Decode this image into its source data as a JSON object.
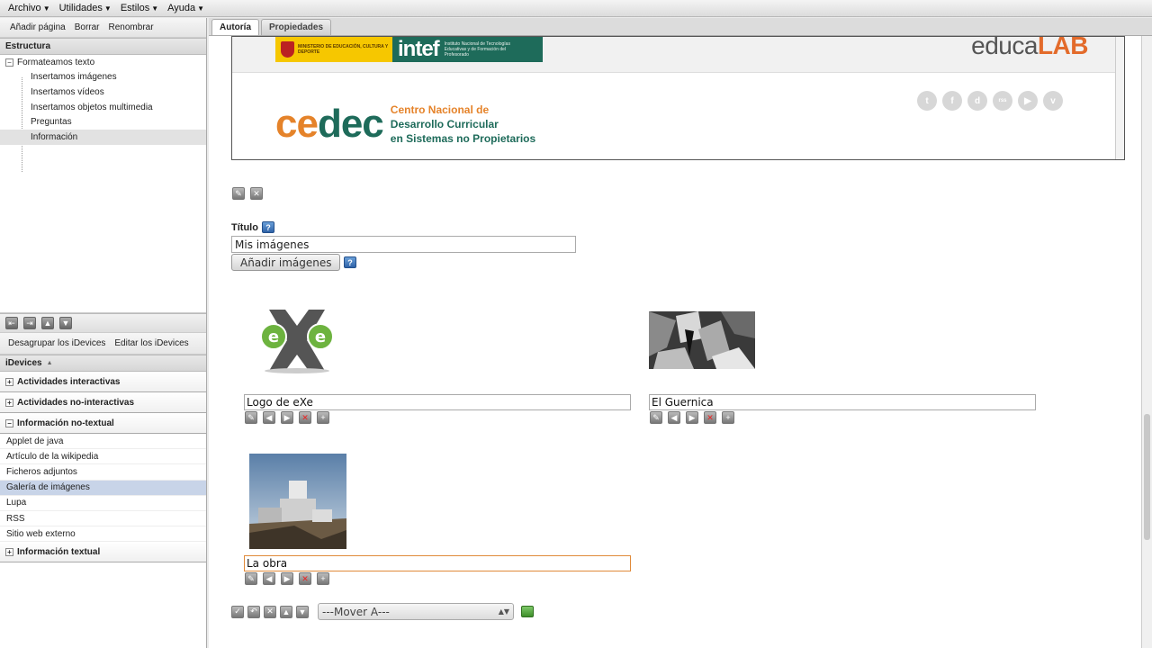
{
  "menubar": {
    "items": [
      "Archivo",
      "Utilidades",
      "Estilos",
      "Ayuda"
    ]
  },
  "left": {
    "toolbar": [
      "Añadir página",
      "Borrar",
      "Renombrar"
    ],
    "structure_title": "Estructura",
    "tree_root": "Formateamos texto",
    "tree_children": [
      "Insertamos imágenes",
      "Insertamos vídeos",
      "Insertamos objetos multimedia",
      "Preguntas",
      "Información"
    ],
    "selected_child_index": 4,
    "idevice_toolbar": [
      "Desagrupar los iDevices",
      "Editar los iDevices"
    ],
    "idevices_title": "iDevices",
    "groups": [
      "Actividades interactivas",
      "Actividades no-interactivas",
      "Información no-textual",
      "Información textual"
    ],
    "nontextual_items": [
      "Applet de java",
      "Artículo de la wikipedia",
      "Ficheros adjuntos",
      "Galería de imágenes",
      "Lupa",
      "RSS",
      "Sitio web externo"
    ],
    "selected_item_index": 3
  },
  "right": {
    "tabs": [
      "Autoría",
      "Propiedades"
    ],
    "active_tab": "Autoría",
    "header": {
      "intef_word": "intef",
      "intef_sub": "Instituto Nacional de Tecnologías Educativas y de Formación del Profesorado",
      "gob_text": "MINISTERIO DE EDUCACIÓN, CULTURA Y DEPORTE",
      "educalab_a": "educa",
      "educalab_b": "LAB",
      "cedec_a": "ce",
      "cedec_b": "dec",
      "cedec_desc_1": "Centro Nacional de",
      "cedec_desc_2": "Desarrollo Curricular",
      "cedec_desc_3": "en Sistemas no Propietarios",
      "social": [
        "t",
        "f",
        "d",
        "rss",
        "▶",
        "v"
      ]
    },
    "form": {
      "title_label": "Título",
      "title_value": "Mis imágenes",
      "add_images": "Añadir imágenes"
    },
    "images": [
      {
        "caption": "Logo de eXe"
      },
      {
        "caption": "El Guernica"
      },
      {
        "caption": "La obra"
      }
    ],
    "mover_label": "---Mover A---"
  },
  "colors": {
    "intef_green": "#1e6b5a",
    "cedec_orange": "#e5832a",
    "selection_blue": "#c8d4e8"
  }
}
